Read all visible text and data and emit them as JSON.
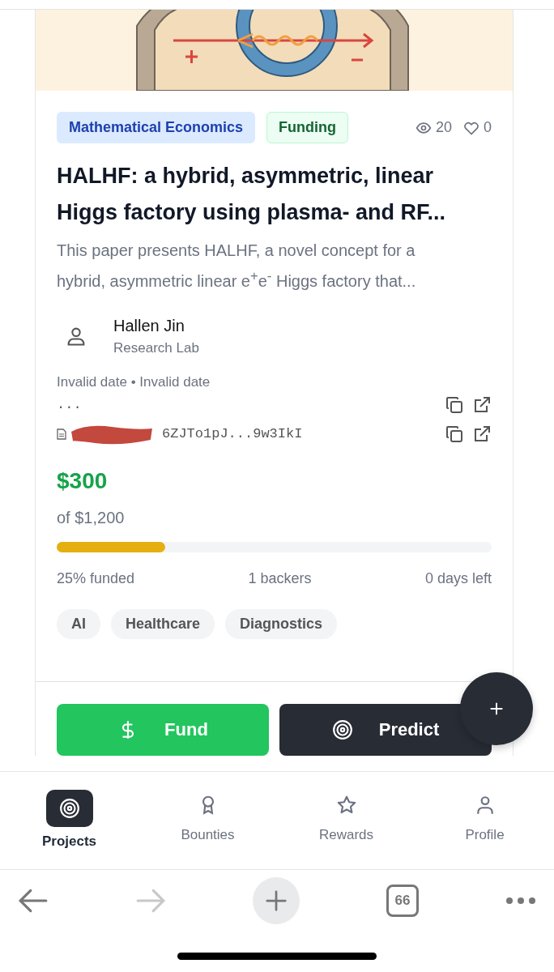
{
  "illustration": {
    "kind": "picture"
  },
  "badges": [
    {
      "label": "Mathematical Economics",
      "kind": "category"
    },
    {
      "label": "Funding",
      "kind": "status"
    }
  ],
  "stats": {
    "views": "20",
    "likes": "0"
  },
  "title": "HALHF: a hybrid, asymmetric, linear Higgs factory using plasma- and RF...",
  "description": "This paper presents HALHF, a novel concept for a hybrid, asymmetric linear e$^{+}$e$^{-}$ Higgs factory that...",
  "author": {
    "name": "Hallen Jin",
    "affiliation": "Research Lab"
  },
  "dates": "Invalid date • Invalid date",
  "links": [
    {
      "text": "...",
      "kind": "plain"
    },
    {
      "text": "6ZJTo1pJ...9w3IkI",
      "kind": "arweave"
    }
  ],
  "funding": {
    "raised": "$300",
    "goal": "of $1,200",
    "level": 0.25,
    "funded": "25% funded",
    "backers": "1 backers",
    "time_left": "0 days left"
  },
  "topics": [
    "AI",
    "Healthcare",
    "Diagnostics"
  ],
  "actions": [
    {
      "label": "Fund",
      "kind": "fund"
    },
    {
      "label": "Predict",
      "kind": "predict"
    }
  ],
  "nav": [
    {
      "label": "Projects",
      "selected": true
    },
    {
      "label": "Bounties",
      "selected": false
    },
    {
      "label": "Rewards",
      "selected": false
    },
    {
      "label": "Profile",
      "selected": false
    }
  ],
  "browser": {
    "tab_count": "66",
    "forward_disabled": true
  }
}
